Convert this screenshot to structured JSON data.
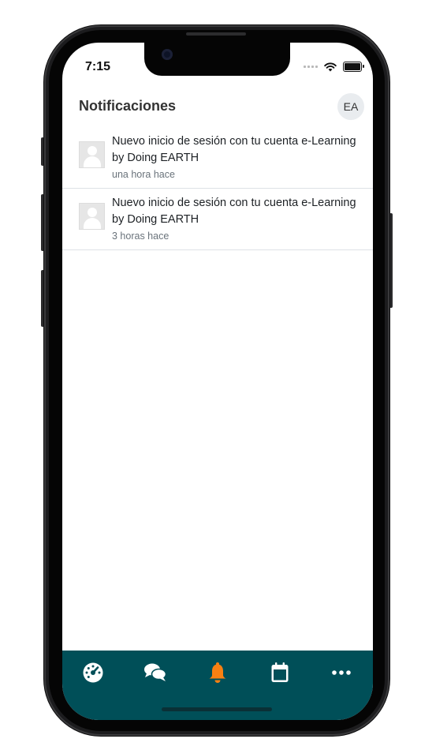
{
  "status_bar": {
    "time": "7:15"
  },
  "header": {
    "title": "Notificaciones",
    "avatar_initials": "EA"
  },
  "notifications": [
    {
      "title": "Nuevo inicio de sesión con tu cuenta e-Learning by Doing EARTH",
      "time": "una hora hace"
    },
    {
      "title": "Nuevo inicio de sesión con tu cuenta e-Learning by Doing EARTH",
      "time": "3 horas hace"
    }
  ],
  "tabbar": {
    "items": [
      {
        "icon": "dashboard-icon",
        "active": false
      },
      {
        "icon": "messages-icon",
        "active": false
      },
      {
        "icon": "bell-icon",
        "active": true
      },
      {
        "icon": "calendar-icon",
        "active": false
      },
      {
        "icon": "more-icon",
        "active": false
      }
    ]
  },
  "colors": {
    "tabbar": "#004f58",
    "active_icon": "#f98012",
    "inactive_icon": "#ffffff"
  }
}
